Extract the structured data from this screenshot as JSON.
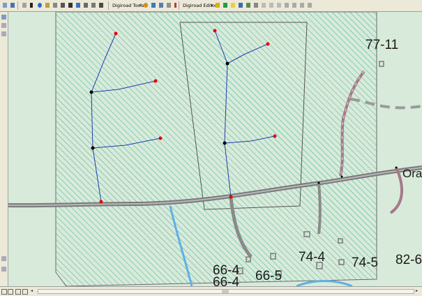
{
  "toolbar": {
    "digiroad_tools_label": "Digiroad Tools",
    "digiroad_editor_label": "Digiroad Editor"
  },
  "map": {
    "parcel_labels": [
      "77-11",
      "66-4",
      "66-4",
      "66-5",
      "74-4",
      "74-5",
      "82-6"
    ],
    "road_label": "Ora",
    "colors": {
      "map_background": "#d8ead9",
      "hatched_area": "#3fae9a",
      "road": "#8a8a8a",
      "link_line": "#1b3fae",
      "endpoint_node": "#e60000",
      "junction_node": "#000000",
      "watercourse": "#5fb0e6",
      "highlighted_path": "#a6788a"
    }
  }
}
